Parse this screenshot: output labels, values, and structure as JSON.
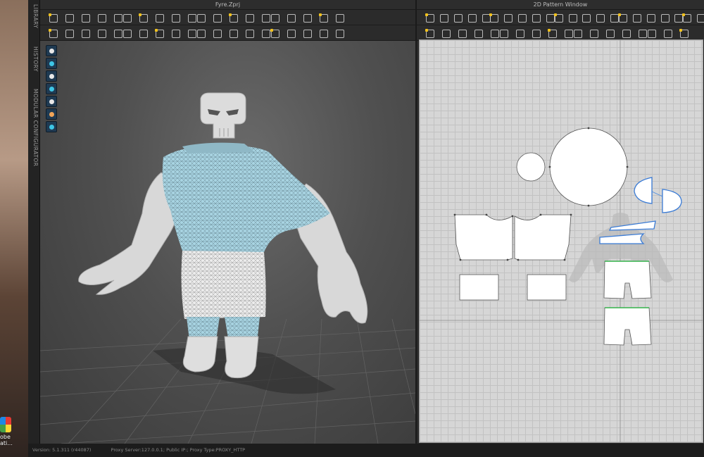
{
  "desktop": {
    "app_label": "obe ati..."
  },
  "side_tabs": [
    "LIBRARY",
    "HISTORY",
    "MODULAR CONFIGURATOR"
  ],
  "window_3d": {
    "title": "Fyre.Zprj"
  },
  "window_2d": {
    "title": "2D Pattern Window"
  },
  "toolbar_3d_row1": [
    "select-move",
    "add-point",
    "edit-pattern",
    "transform",
    "folder",
    "fold",
    "rotate",
    "seam",
    "pin",
    "sewing",
    "fabric",
    "tacking",
    "freeze",
    "layers",
    "strengthen",
    "grid"
  ],
  "toolbar_3d_row2": [
    "avatar",
    "add-avatar",
    "arrange",
    "measure",
    "tape",
    "arrangement",
    "trim",
    "hide",
    "skin",
    "show",
    "mesh",
    "gizmo",
    "flatten",
    "points",
    "line",
    "axis"
  ],
  "toolbar_2d_row1": [
    "transform",
    "edit-point",
    "edit-curve",
    "add-point",
    "polygon",
    "rectangle",
    "circle",
    "internal-line",
    "dart",
    "trace",
    "sew",
    "fold",
    "notch",
    "sewing",
    "gather",
    "pleat",
    "grid-a",
    "grid-b"
  ],
  "toolbar_2d_row2": [
    "edit-sewing",
    "segment-sewing",
    "free-sewing",
    "merge",
    "flip",
    "topstitch",
    "texture",
    "button",
    "buttonhole",
    "zipper",
    "puckering",
    "elastic",
    "line",
    "measure",
    "ruler"
  ],
  "viewport_3d_tools": [
    "shirt",
    "fabric-loop",
    "avatar-person",
    "texture-mode",
    "tape-measure",
    "skin-person",
    "globe"
  ],
  "status": {
    "version": "Version: 5.1.311 (r44087)",
    "proxy": "Proxy Server:127.0.0.1; Public IP:; Proxy Type:PROXY_HTTP"
  },
  "colors": {
    "viewport_bg": "#555555",
    "avatar": "#dcdcdc",
    "fabric_blue": "#a8d4e2",
    "fabric_white": "#e8e8e8",
    "pattern_bg": "#d6d6d6",
    "pattern_piece": "#ffffff",
    "selected_outline": "#3a7bd5",
    "seam_green": "#33b24a",
    "icon_accent": "#f2c21b"
  }
}
